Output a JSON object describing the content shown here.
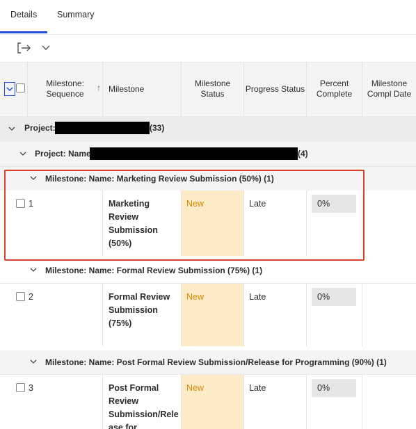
{
  "tabs": [
    {
      "label": "Details",
      "active": true
    },
    {
      "label": "Summary",
      "active": false
    }
  ],
  "toolbar": {
    "export_icon": "export-icon",
    "dropdown_icon": "chevron-down-icon"
  },
  "columns": {
    "sequence": [
      "Milestone:",
      "Sequence"
    ],
    "milestone": "Milestone",
    "status": [
      "Milestone",
      "Status"
    ],
    "progress": "Progress Status",
    "percent": [
      "Percent",
      "Complete"
    ],
    "compl": [
      "Milestone",
      "Compl Date"
    ]
  },
  "group_project": {
    "label": "Project:",
    "count": "(33)"
  },
  "group_project_name": {
    "label": "Project: Name",
    "count": "(4)"
  },
  "milestones": [
    {
      "group_label": "Milestone: Name: Marketing Review Submission (50%) (1)",
      "sequence": "1",
      "name_lines": [
        "Marketing",
        "Review",
        "Submission",
        "(50%)"
      ],
      "status": "New",
      "progress": "Late",
      "percent": "0%"
    },
    {
      "group_label": "Milestone: Name: Formal Review Submission (75%) (1)",
      "sequence": "2",
      "name_lines": [
        "Formal Review",
        "Submission",
        "(75%)"
      ],
      "status": "New",
      "progress": "Late",
      "percent": "0%"
    },
    {
      "group_label": "Milestone: Name: Post Formal Review Submission/Release for Programming (90%) (1)",
      "sequence": "3",
      "name_lines": [
        "Post Formal",
        "Review",
        "Submission/Rele",
        "ase for"
      ],
      "status": "New",
      "progress": "Late",
      "percent": "0%"
    }
  ],
  "colors": {
    "accent": "#1d4fd8",
    "status_new_bg": "#fdebc8",
    "status_new_text": "#d68a00",
    "highlight": "#d9432b"
  }
}
